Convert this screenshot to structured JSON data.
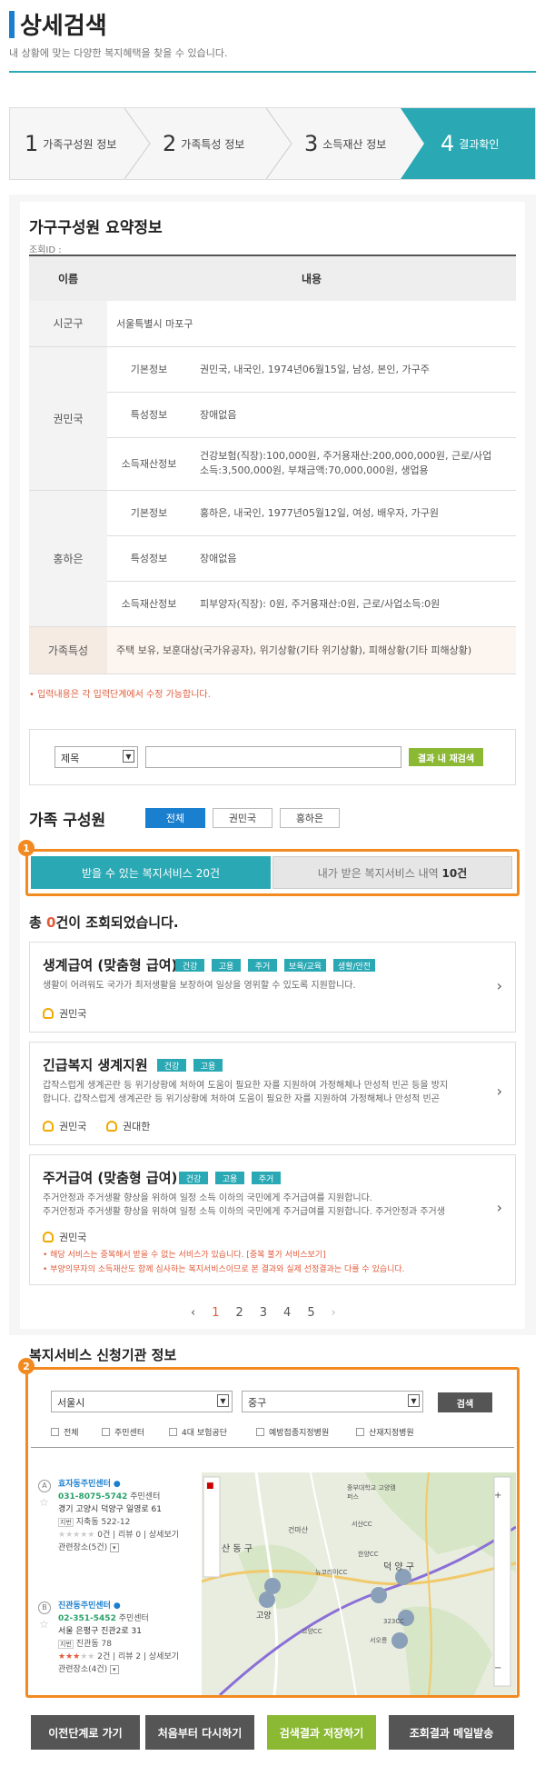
{
  "header": {
    "title": "상세검색",
    "subtitle": "내 상황에 맞는 다양한 복지혜택을 찾을 수 있습니다."
  },
  "steps": [
    {
      "num": "1",
      "label": "가족구성원 정보"
    },
    {
      "num": "2",
      "label": "가족특성 정보"
    },
    {
      "num": "3",
      "label": "소득재산 정보"
    },
    {
      "num": "4",
      "label": "결과확인"
    }
  ],
  "summary": {
    "title": "가구구성원 요약정보",
    "query_id_label": "조회ID :",
    "col_name": "이름",
    "col_content": "내용",
    "region_label": "시군구",
    "region_value": "서울특별시 마포구",
    "members": [
      {
        "name": "권민국",
        "basic_label": "기본정보",
        "basic": "권민국, 내국인, 1974년06월15일, 남성, 본인, 가구주",
        "trait_label": "특성정보",
        "trait": "장애없음",
        "income_label": "소득재산정보",
        "income_line1": "건강보험(직장):100,000원, 주거용재산:200,000,000원, 근로/사업",
        "income_line2": "소득:3,500,000원, 부채금액:70,000,000원, 생업용"
      },
      {
        "name": "홍하은",
        "basic_label": "기본정보",
        "basic": "홍하은, 내국인, 1977년05월12일, 여성, 배우자, 가구원",
        "trait_label": "특성정보",
        "trait": "장애없음",
        "income_label": "소득재산정보",
        "income_line1": "피부양자(직장): 0원, 주거용재산:0원, 근로/사업소득:0원"
      }
    ],
    "family_label": "가족특성",
    "family_value": "주택 보유, 보훈대상(국가유공자), 위기상황(기타 위기상황), 피해상황(기타 피해상황)",
    "note": "• 입력내용은 각 입력단계에서 수정 가능합니다."
  },
  "search": {
    "select_value": "제목",
    "input_value": "",
    "button": "결과 내 재검색"
  },
  "family_members": {
    "title": "가족 구성원",
    "pills": [
      "전체",
      "권민국",
      "홍하은"
    ]
  },
  "badges": {
    "one": "1",
    "two": "2"
  },
  "tabs": {
    "left_label": "받을 수 있는 복지서비스",
    "left_count": "20건",
    "right_label": "내가 받은 복지서비스 내역",
    "right_count": "10건"
  },
  "results": {
    "prefix": "총 ",
    "count": "0",
    "suffix": "건이 조회되었습니다."
  },
  "cards": [
    {
      "title": "생계급여 (맞춤형 급여)",
      "tags": [
        "건강",
        "고용",
        "주거",
        "보육/교육",
        "생활/안전"
      ],
      "desc1": "생활이 어려워도 국가가 최저생활을 보장하여 일상을 영위할 수 있도록 지원합니다.",
      "people": [
        "권민국"
      ]
    },
    {
      "title": "긴급복지 생계지원",
      "tags": [
        "건강",
        "고용"
      ],
      "desc1": "갑작스럽게 생계곤란 등 위기상황에 처하여 도움이 필요한 자를 지원하여 가정해체나 만성적 빈곤 등을 방지",
      "desc2": "합니다. 갑작스럽게 생계곤란 등 위기상황에 처하여 도움이 필요한 자를 지원하여 가정해체나 만성적 빈곤",
      "people": [
        "권민국",
        "권대한"
      ]
    },
    {
      "title": "주거급여 (맞춤형 급여)",
      "tags": [
        "건강",
        "고용",
        "주거"
      ],
      "desc1": "주거안정과 주거생활 향상을 위하여 일정 소득 이하의 국민에게 주거급여를 지원합니다.",
      "desc2": "주거안정과 주거생활 향상을 위하여 일정 소득 이하의 국민에게 주거급여를 지원합니다. 주거안정과 주거생",
      "people": [
        "권민국"
      ],
      "warn1": "해당 서비스는 중복해서 받을 수 없는 서비스가 있습니다. [중복 불가 서비스보기]",
      "warn2": "부양의무자의 소득재산도 함께 심사하는 복지서비스이므로 본 결과와 실제 선정결과는 다를 수 있습니다."
    }
  ],
  "pager": {
    "prev": "‹",
    "pages": [
      "1",
      "2",
      "3",
      "4",
      "5"
    ],
    "next": "›"
  },
  "agency": {
    "title": "복지서비스 신청기관 정보",
    "city": "서울시",
    "district": "중구",
    "search_button": "검색",
    "filters": [
      "전체",
      "주민센터",
      "4대 보험공단",
      "예방접종지정병원",
      "산재지정병원"
    ],
    "locations": [
      {
        "marker": "A",
        "name": "효자동주민센터",
        "phone": "031-8075-5742",
        "type": "주민센터",
        "addr": "경기 고양시 덕양구 일영로 61",
        "lot_label": "지번",
        "lot": "지축동 522-12",
        "stats": "0건 | 리뷰 0 | 상세보기",
        "related": "관련장소(5건)"
      },
      {
        "marker": "B",
        "name": "진관동주민센터",
        "phone": "02-351-5452",
        "type": "주민센터",
        "addr": "서울 은평구 진관2로 31",
        "lot_label": "지번",
        "lot": "진관동 78",
        "stats": "2건 | 리뷰 2 | 상세보기",
        "related": "관련장소(4건)"
      }
    ],
    "map_labels": [
      "건마산",
      "산 동 구",
      "고양",
      "한양CC",
      "뉴코리아CC",
      "덕 양 구",
      "323CC",
      "서오릉",
      "중부대학교 고양캠퍼스",
      "고양CC",
      "서산CC"
    ]
  },
  "buttons": {
    "prev_step": "이전단계로 가기",
    "restart": "처음부터 다시하기",
    "save": "검색결과 저장하기",
    "email": "조회결과 메일발송"
  },
  "colors": {
    "teal": "#2aa9b5",
    "blue": "#1b7fcf",
    "orange": "#f28a20",
    "green": "#8cb934",
    "red": "#e25b3a",
    "dark": "#555555"
  }
}
